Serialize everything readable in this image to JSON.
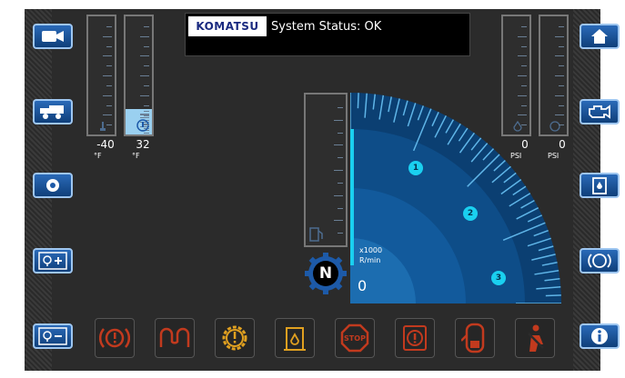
{
  "header": {
    "logo_text": "KOMATSU",
    "status_text": "System Status: OK"
  },
  "left_buttons": [
    {
      "icon": "camera-icon"
    },
    {
      "icon": "machine-icon"
    },
    {
      "icon": "settings-icon"
    },
    {
      "icon": "brightness-up-icon"
    },
    {
      "icon": "brightness-down-icon"
    }
  ],
  "right_buttons": [
    {
      "icon": "home-icon"
    },
    {
      "icon": "engine-icon"
    },
    {
      "icon": "fluid-icon"
    },
    {
      "icon": "brake-icon"
    },
    {
      "icon": "info-icon"
    }
  ],
  "gauges": {
    "temp1": {
      "value": "-40",
      "unit": "°F"
    },
    "temp2": {
      "value": "32",
      "unit": "°F"
    },
    "psi1": {
      "value": "0",
      "unit": "PSI"
    },
    "psi2": {
      "value": "0",
      "unit": "PSI"
    }
  },
  "tach": {
    "unit_line1": "x1000",
    "unit_line2": "R/min",
    "value": "0",
    "labels": [
      "1",
      "2",
      "3"
    ]
  },
  "gear": {
    "value": "N"
  },
  "warning_icons": [
    {
      "name": "parking-brake-warning-icon",
      "color": "#c23a1e"
    },
    {
      "name": "preheat-warning-icon",
      "color": "#c23a1e"
    },
    {
      "name": "engine-gear-warning-icon",
      "color": "#e0a020"
    },
    {
      "name": "fluid-level-warning-icon",
      "color": "#e0a020"
    },
    {
      "name": "stop-warning-icon",
      "color": "#c23a1e"
    },
    {
      "name": "general-warning-icon",
      "color": "#c23a1e"
    },
    {
      "name": "door-open-warning-icon",
      "color": "#c23a1e"
    },
    {
      "name": "seatbelt-warning-icon",
      "color": "#c23a1e"
    }
  ],
  "colors": {
    "button_blue": "#1d5aa8",
    "tach_blue": "#0d4f8c",
    "accent_cyan": "#1ad0f0"
  }
}
